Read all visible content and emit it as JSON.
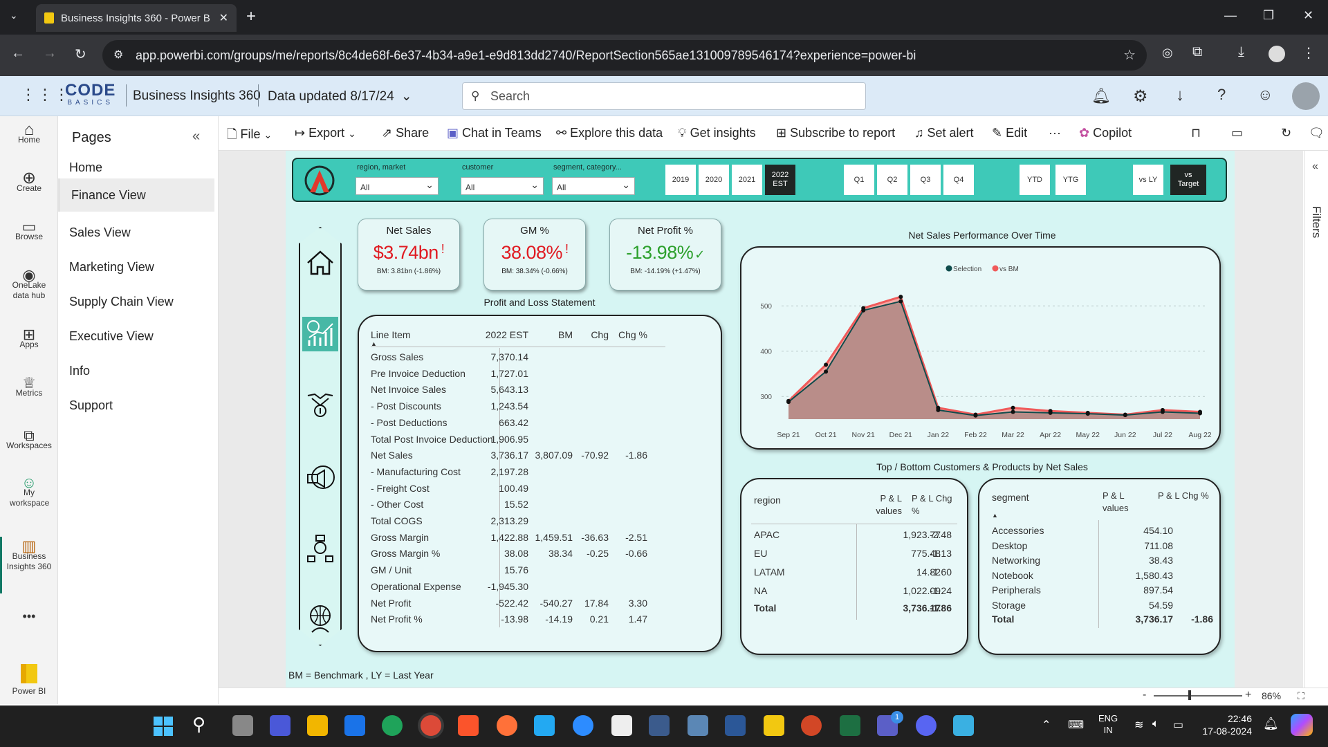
{
  "browser": {
    "tab_title": "Business Insights 360 - Power B",
    "url": "app.powerbi.com/groups/me/reports/8c4de68f-6e37-4b34-a9e1-e9d813dd2740/ReportSection565ae131009789546174?experience=power-bi"
  },
  "header": {
    "logo_main": "ODE",
    "logo_sub": "BASICS",
    "app_name": "Business Insights 360",
    "data_updated": "Data updated 8/17/24",
    "search_placeholder": "Search"
  },
  "left_rail": [
    {
      "label": "Home",
      "icon": "home-icon"
    },
    {
      "label": "Create",
      "icon": "plus-circle-icon"
    },
    {
      "label": "Browse",
      "icon": "folder-icon"
    },
    {
      "label": "OneLake data hub",
      "icon": "onelake-icon"
    },
    {
      "label": "Apps",
      "icon": "apps-icon"
    },
    {
      "label": "Metrics",
      "icon": "trophy-icon"
    },
    {
      "label": "Workspaces",
      "icon": "workspaces-icon"
    },
    {
      "label": "My workspace",
      "icon": "person-icon"
    },
    {
      "label": "Business Insights 360",
      "icon": "report-icon"
    },
    {
      "label": "•••",
      "icon": "more-icon"
    },
    {
      "label": "Power BI",
      "icon": "powerbi-logo"
    }
  ],
  "pages": {
    "title": "Pages",
    "items": [
      "Home",
      "Finance View",
      "Sales View",
      "Marketing View",
      "Supply Chain View",
      "Executive View",
      "Info",
      "Support"
    ],
    "active": 1
  },
  "toolbar": {
    "file": "File",
    "export": "Export",
    "share": "Share",
    "chat": "Chat in Teams",
    "explore": "Explore this data",
    "insights": "Get insights",
    "subscribe": "Subscribe to report",
    "alert": "Set alert",
    "edit": "Edit",
    "more": "···",
    "copilot": "Copilot"
  },
  "filters": {
    "f1_label": "region, market",
    "f1_value": "All",
    "f2_label": "customer",
    "f2_value": "All",
    "f3_label": "segment, category...",
    "f3_value": "All",
    "years": [
      "2019",
      "2020",
      "2021",
      "2022 EST"
    ],
    "selected_year": "2022 EST",
    "quarters": [
      "Q1",
      "Q2",
      "Q3",
      "Q4"
    ],
    "ytd": "YTD",
    "ytg": "YTG",
    "vs_ly": "vs LY",
    "vs_target": "vs Target"
  },
  "kpis": [
    {
      "title": "Net Sales",
      "value": "$3.74bn",
      "mark": "!",
      "sub": "BM: 3.81bn (-1.86%)",
      "color": "#e01b22"
    },
    {
      "title": "GM %",
      "value": "38.08%",
      "mark": "!",
      "sub": "BM: 38.34% (-0.66%)",
      "color": "#e01b22"
    },
    {
      "title": "Net Profit %",
      "value": "-13.98%",
      "mark": "✓",
      "sub": "BM: -14.19% (+1.47%)",
      "color": "#2ca02c"
    }
  ],
  "pl": {
    "title": "Profit and Loss Statement",
    "headers": [
      "Line Item",
      "2022 EST",
      "BM",
      "Chg",
      "Chg %"
    ],
    "rows": [
      [
        "Gross Sales",
        "7,370.14",
        "",
        "",
        ""
      ],
      [
        "Pre Invoice Deduction",
        "1,727.01",
        "",
        "",
        ""
      ],
      [
        "Net Invoice Sales",
        "5,643.13",
        "",
        "",
        ""
      ],
      [
        "- Post Discounts",
        "1,243.54",
        "",
        "",
        ""
      ],
      [
        "- Post Deductions",
        "663.42",
        "",
        "",
        ""
      ],
      [
        "Total Post Invoice Deduction",
        "1,906.95",
        "",
        "",
        ""
      ],
      [
        "Net Sales",
        "3,736.17",
        "3,807.09",
        "-70.92",
        "-1.86"
      ],
      [
        "- Manufacturing Cost",
        "2,197.28",
        "",
        "",
        ""
      ],
      [
        "- Freight Cost",
        "100.49",
        "",
        "",
        ""
      ],
      [
        "- Other Cost",
        "15.52",
        "",
        "",
        ""
      ],
      [
        "Total COGS",
        "2,313.29",
        "",
        "",
        ""
      ],
      [
        "Gross Margin",
        "1,422.88",
        "1,459.51",
        "-36.63",
        "-2.51"
      ],
      [
        "Gross Margin %",
        "38.08",
        "38.34",
        "-0.25",
        "-0.66"
      ],
      [
        "GM / Unit",
        "15.76",
        "",
        "",
        ""
      ],
      [
        "Operational Expense",
        "-1,945.30",
        "",
        "",
        ""
      ],
      [
        "Net Profit",
        "-522.42",
        "-540.27",
        "17.84",
        "3.30"
      ],
      [
        "Net Profit %",
        "-13.98",
        "-14.19",
        "0.21",
        "1.47"
      ]
    ]
  },
  "chart_data": {
    "type": "area",
    "title": "Net Sales Performance Over Time",
    "x": [
      "Sep 21",
      "Oct 21",
      "Nov 21",
      "Dec 21",
      "Jan 22",
      "Feb 22",
      "Mar 22",
      "Apr 22",
      "May 22",
      "Jun 22",
      "Jul 22",
      "Aug 22"
    ],
    "series": [
      {
        "name": "Selection",
        "color": "#0f4c4c",
        "values": [
          288,
          355,
          490,
          510,
          270,
          258,
          266,
          264,
          262,
          259,
          266,
          263
        ]
      },
      {
        "name": "vs BM",
        "color": "#f05a5a",
        "values": [
          290,
          370,
          495,
          520,
          275,
          260,
          275,
          268,
          264,
          260,
          270,
          266
        ]
      }
    ],
    "yticks": [
      300,
      400,
      500
    ],
    "ylim": [
      250,
      540
    ],
    "legend": "top",
    "grid": true
  },
  "region_table": {
    "title": "Top / Bottom Customers & Products by Net Sales",
    "headers": [
      "region",
      "P & L values",
      "P & L Chg %"
    ],
    "rows": [
      [
        "APAC",
        "1,923.77",
        "-2.48"
      ],
      [
        "EU",
        "775.48",
        "-1.13"
      ],
      [
        "LATAM",
        "14.82",
        "-1.60"
      ],
      [
        "NA",
        "1,022.09",
        "-1.24"
      ]
    ],
    "total": [
      "Total",
      "3,736.17",
      "-1.86"
    ]
  },
  "segment_table": {
    "headers": [
      "segment",
      "P & L values",
      "P & L Chg %"
    ],
    "rows": [
      [
        "Accessories",
        "454.10",
        ""
      ],
      [
        "Desktop",
        "711.08",
        ""
      ],
      [
        "Networking",
        "38.43",
        ""
      ],
      [
        "Notebook",
        "1,580.43",
        ""
      ],
      [
        "Peripherals",
        "897.54",
        ""
      ],
      [
        "Storage",
        "54.59",
        ""
      ]
    ],
    "total": [
      "Total",
      "3,736.17",
      "-1.86"
    ]
  },
  "footnote": "BM = Benchmark , LY = Last Year",
  "right_rail": "Filters",
  "zoom": "86%",
  "taskbar": {
    "lang1": "ENG",
    "lang2": "IN",
    "time": "22:46",
    "date": "17-08-2024",
    "teams_badge": "1"
  }
}
